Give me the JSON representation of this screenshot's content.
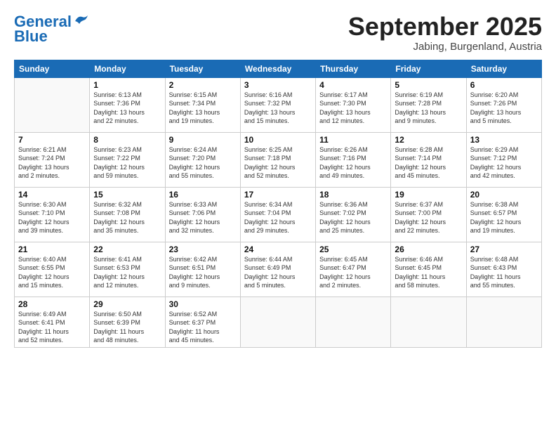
{
  "logo": {
    "line1": "General",
    "line2": "Blue"
  },
  "header": {
    "month": "September 2025",
    "location": "Jabing, Burgenland, Austria"
  },
  "weekdays": [
    "Sunday",
    "Monday",
    "Tuesday",
    "Wednesday",
    "Thursday",
    "Friday",
    "Saturday"
  ],
  "days": [
    {
      "num": "",
      "info": ""
    },
    {
      "num": "1",
      "info": "Sunrise: 6:13 AM\nSunset: 7:36 PM\nDaylight: 13 hours\nand 22 minutes."
    },
    {
      "num": "2",
      "info": "Sunrise: 6:15 AM\nSunset: 7:34 PM\nDaylight: 13 hours\nand 19 minutes."
    },
    {
      "num": "3",
      "info": "Sunrise: 6:16 AM\nSunset: 7:32 PM\nDaylight: 13 hours\nand 15 minutes."
    },
    {
      "num": "4",
      "info": "Sunrise: 6:17 AM\nSunset: 7:30 PM\nDaylight: 13 hours\nand 12 minutes."
    },
    {
      "num": "5",
      "info": "Sunrise: 6:19 AM\nSunset: 7:28 PM\nDaylight: 13 hours\nand 9 minutes."
    },
    {
      "num": "6",
      "info": "Sunrise: 6:20 AM\nSunset: 7:26 PM\nDaylight: 13 hours\nand 5 minutes."
    },
    {
      "num": "7",
      "info": "Sunrise: 6:21 AM\nSunset: 7:24 PM\nDaylight: 13 hours\nand 2 minutes."
    },
    {
      "num": "8",
      "info": "Sunrise: 6:23 AM\nSunset: 7:22 PM\nDaylight: 12 hours\nand 59 minutes."
    },
    {
      "num": "9",
      "info": "Sunrise: 6:24 AM\nSunset: 7:20 PM\nDaylight: 12 hours\nand 55 minutes."
    },
    {
      "num": "10",
      "info": "Sunrise: 6:25 AM\nSunset: 7:18 PM\nDaylight: 12 hours\nand 52 minutes."
    },
    {
      "num": "11",
      "info": "Sunrise: 6:26 AM\nSunset: 7:16 PM\nDaylight: 12 hours\nand 49 minutes."
    },
    {
      "num": "12",
      "info": "Sunrise: 6:28 AM\nSunset: 7:14 PM\nDaylight: 12 hours\nand 45 minutes."
    },
    {
      "num": "13",
      "info": "Sunrise: 6:29 AM\nSunset: 7:12 PM\nDaylight: 12 hours\nand 42 minutes."
    },
    {
      "num": "14",
      "info": "Sunrise: 6:30 AM\nSunset: 7:10 PM\nDaylight: 12 hours\nand 39 minutes."
    },
    {
      "num": "15",
      "info": "Sunrise: 6:32 AM\nSunset: 7:08 PM\nDaylight: 12 hours\nand 35 minutes."
    },
    {
      "num": "16",
      "info": "Sunrise: 6:33 AM\nSunset: 7:06 PM\nDaylight: 12 hours\nand 32 minutes."
    },
    {
      "num": "17",
      "info": "Sunrise: 6:34 AM\nSunset: 7:04 PM\nDaylight: 12 hours\nand 29 minutes."
    },
    {
      "num": "18",
      "info": "Sunrise: 6:36 AM\nSunset: 7:02 PM\nDaylight: 12 hours\nand 25 minutes."
    },
    {
      "num": "19",
      "info": "Sunrise: 6:37 AM\nSunset: 7:00 PM\nDaylight: 12 hours\nand 22 minutes."
    },
    {
      "num": "20",
      "info": "Sunrise: 6:38 AM\nSunset: 6:57 PM\nDaylight: 12 hours\nand 19 minutes."
    },
    {
      "num": "21",
      "info": "Sunrise: 6:40 AM\nSunset: 6:55 PM\nDaylight: 12 hours\nand 15 minutes."
    },
    {
      "num": "22",
      "info": "Sunrise: 6:41 AM\nSunset: 6:53 PM\nDaylight: 12 hours\nand 12 minutes."
    },
    {
      "num": "23",
      "info": "Sunrise: 6:42 AM\nSunset: 6:51 PM\nDaylight: 12 hours\nand 9 minutes."
    },
    {
      "num": "24",
      "info": "Sunrise: 6:44 AM\nSunset: 6:49 PM\nDaylight: 12 hours\nand 5 minutes."
    },
    {
      "num": "25",
      "info": "Sunrise: 6:45 AM\nSunset: 6:47 PM\nDaylight: 12 hours\nand 2 minutes."
    },
    {
      "num": "26",
      "info": "Sunrise: 6:46 AM\nSunset: 6:45 PM\nDaylight: 11 hours\nand 58 minutes."
    },
    {
      "num": "27",
      "info": "Sunrise: 6:48 AM\nSunset: 6:43 PM\nDaylight: 11 hours\nand 55 minutes."
    },
    {
      "num": "28",
      "info": "Sunrise: 6:49 AM\nSunset: 6:41 PM\nDaylight: 11 hours\nand 52 minutes."
    },
    {
      "num": "29",
      "info": "Sunrise: 6:50 AM\nSunset: 6:39 PM\nDaylight: 11 hours\nand 48 minutes."
    },
    {
      "num": "30",
      "info": "Sunrise: 6:52 AM\nSunset: 6:37 PM\nDaylight: 11 hours\nand 45 minutes."
    },
    {
      "num": "",
      "info": ""
    },
    {
      "num": "",
      "info": ""
    },
    {
      "num": "",
      "info": ""
    },
    {
      "num": "",
      "info": ""
    }
  ]
}
